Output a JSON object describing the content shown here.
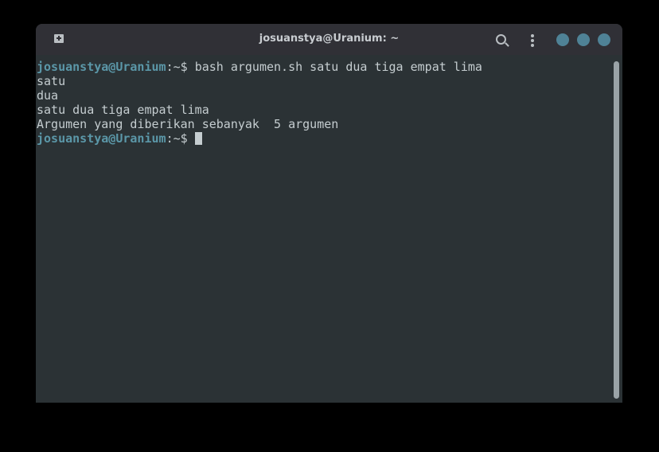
{
  "window": {
    "title": "josuanstya@Uranium: ~"
  },
  "terminal": {
    "prompt": "josuanstya@Uranium",
    "prompt_suffix": ":~$ ",
    "command": "bash argumen.sh satu dua tiga empat lima",
    "output": [
      "satu",
      "dua",
      "satu dua tiga empat lima",
      "Argumen yang diberikan sebanyak  5 argumen"
    ]
  },
  "colors": {
    "prompt": "#5b97a8",
    "background": "#2b3235",
    "titlebar": "#303036",
    "window_buttons": "#4f8296"
  }
}
